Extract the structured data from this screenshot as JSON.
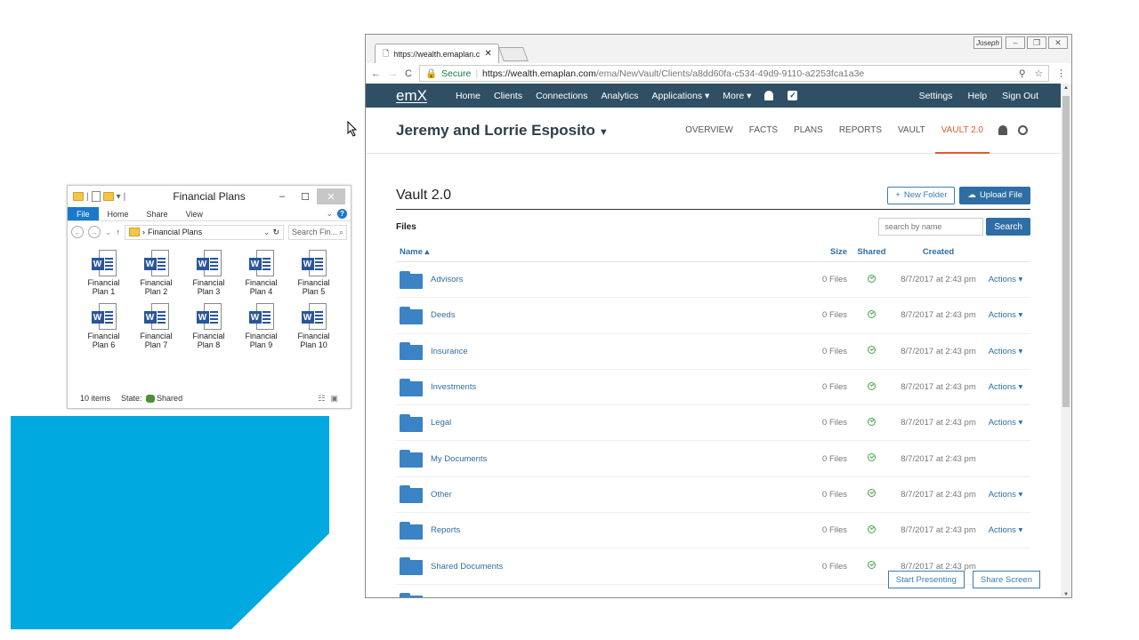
{
  "explorer": {
    "title": "Financial Plans",
    "ribbon_tabs": [
      "File",
      "Home",
      "Share",
      "View"
    ],
    "path": "Financial Plans",
    "search_placeholder": "Search Fin...",
    "files": [
      {
        "l1": "Financial",
        "l2": "Plan 1"
      },
      {
        "l1": "Financial",
        "l2": "Plan 2"
      },
      {
        "l1": "Financial",
        "l2": "Plan 3"
      },
      {
        "l1": "Financial",
        "l2": "Plan 4"
      },
      {
        "l1": "Financial",
        "l2": "Plan 5"
      },
      {
        "l1": "Financial",
        "l2": "Plan 6"
      },
      {
        "l1": "Financial",
        "l2": "Plan 7"
      },
      {
        "l1": "Financial",
        "l2": "Plan 8"
      },
      {
        "l1": "Financial",
        "l2": "Plan 9"
      },
      {
        "l1": "Financial",
        "l2": "Plan 10"
      }
    ],
    "status_count": "10 items",
    "status_state_label": "State:",
    "status_state_value": "Shared"
  },
  "browser": {
    "tab_title": "https://wealth.emaplan.c",
    "profile": "Joseph",
    "secure_label": "Secure",
    "url_host": "https://wealth.emaplan.com",
    "url_path": "/ema/NewVault/Clients/a8dd60fa-c534-49d9-9110-a2253fca1a3e"
  },
  "app": {
    "logo": "emX",
    "nav": [
      "Home",
      "Clients",
      "Connections",
      "Analytics",
      "Applications ▾",
      "More ▾"
    ],
    "nav_right": [
      "Settings",
      "Help",
      "Sign Out"
    ],
    "client_name": "Jeremy and Lorrie Esposito",
    "client_tabs": [
      "OVERVIEW",
      "FACTS",
      "PLANS",
      "REPORTS",
      "VAULT",
      "VAULT 2.0"
    ],
    "active_tab": "VAULT 2.0"
  },
  "vault": {
    "title": "Vault 2.0",
    "new_folder": "New Folder",
    "upload_file": "Upload File",
    "files_label": "Files",
    "search_placeholder": "search by name",
    "search_button": "Search",
    "columns": {
      "name": "Name ▴",
      "size": "Size",
      "shared": "Shared",
      "created": "Created"
    },
    "rows": [
      {
        "name": "Advisors",
        "size": "0 Files",
        "created": "8/7/2017 at 2:43 pm",
        "actions": "Actions ▾"
      },
      {
        "name": "Deeds",
        "size": "0 Files",
        "created": "8/7/2017 at 2:43 pm",
        "actions": "Actions ▾"
      },
      {
        "name": "Insurance",
        "size": "0 Files",
        "created": "8/7/2017 at 2:43 pm",
        "actions": "Actions ▾"
      },
      {
        "name": "Investments",
        "size": "0 Files",
        "created": "8/7/2017 at 2:43 pm",
        "actions": "Actions ▾"
      },
      {
        "name": "Legal",
        "size": "0 Files",
        "created": "8/7/2017 at 2:43 pm",
        "actions": "Actions ▾"
      },
      {
        "name": "My Documents",
        "size": "0 Files",
        "created": "8/7/2017 at 2:43 pm",
        "actions": ""
      },
      {
        "name": "Other",
        "size": "0 Files",
        "created": "8/7/2017 at 2:43 pm",
        "actions": "Actions ▾"
      },
      {
        "name": "Reports",
        "size": "0 Files",
        "created": "8/7/2017 at 2:43 pm",
        "actions": "Actions ▾"
      },
      {
        "name": "Shared Documents",
        "size": "0 Files",
        "created": "8/7/2017 at 2:43 pm",
        "actions": ""
      }
    ],
    "start_presenting": "Start Presenting",
    "share_screen": "Share Screen"
  },
  "colors": {
    "cyan": "#00a9df",
    "nav_bg": "#2f4f64",
    "active_tab": "#e35b2d",
    "link": "#2f6ea5"
  }
}
